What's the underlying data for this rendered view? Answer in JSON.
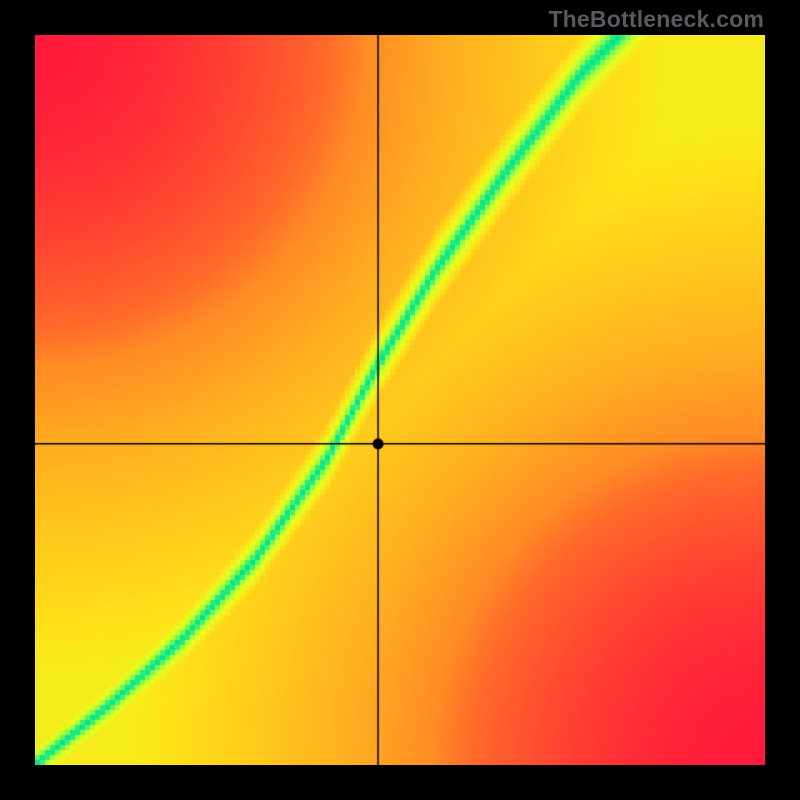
{
  "watermark": "TheBottleneck.com",
  "chart_data": {
    "type": "heatmap",
    "title": "",
    "xlabel": "",
    "ylabel": "",
    "xlim": [
      0,
      1
    ],
    "ylim": [
      0,
      1
    ],
    "crosshair": {
      "x": 0.47,
      "y": 0.44
    },
    "marker": {
      "x": 0.47,
      "y": 0.44
    },
    "ridge_points": [
      {
        "x": 0.0,
        "y": 0.0
      },
      {
        "x": 0.1,
        "y": 0.08
      },
      {
        "x": 0.2,
        "y": 0.17
      },
      {
        "x": 0.3,
        "y": 0.28
      },
      {
        "x": 0.4,
        "y": 0.42
      },
      {
        "x": 0.47,
        "y": 0.55
      },
      {
        "x": 0.55,
        "y": 0.68
      },
      {
        "x": 0.65,
        "y": 0.82
      },
      {
        "x": 0.75,
        "y": 0.95
      },
      {
        "x": 0.8,
        "y": 1.0
      }
    ],
    "ridge_width": 0.06,
    "colorscale": [
      {
        "t": 0.0,
        "color": "#ff1a3a"
      },
      {
        "t": 0.35,
        "color": "#ff6a2a"
      },
      {
        "t": 0.55,
        "color": "#ffb020"
      },
      {
        "t": 0.75,
        "color": "#ffe018"
      },
      {
        "t": 0.88,
        "color": "#e8ff20"
      },
      {
        "t": 0.95,
        "color": "#a0ff40"
      },
      {
        "t": 1.0,
        "color": "#00e590"
      }
    ],
    "background_falloff": 0.9
  }
}
